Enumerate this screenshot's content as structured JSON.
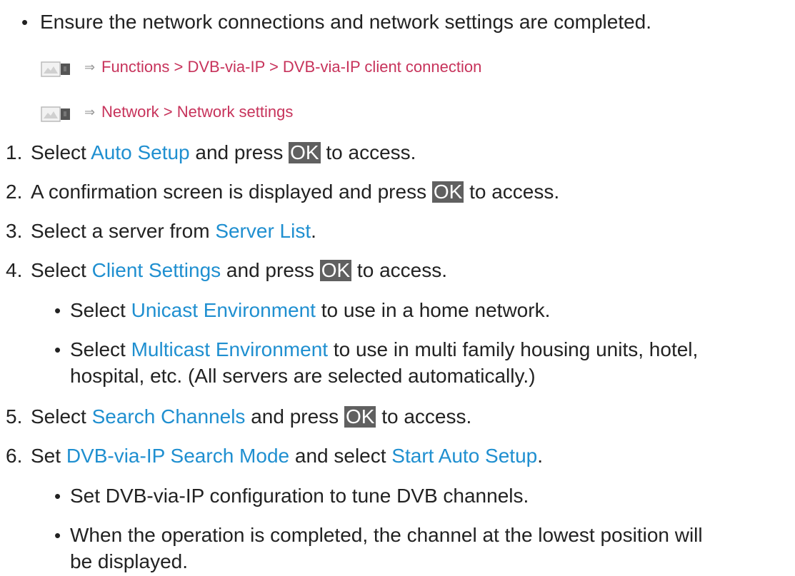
{
  "intro": {
    "bullet": "•",
    "text": "Ensure the network connections and network settings are completed."
  },
  "references": [
    {
      "icon": "tv-menu-icon",
      "arrow": "⇒",
      "path": "Functions > DVB-via-IP > DVB-via-IP client connection"
    },
    {
      "icon": "tv-menu-icon",
      "arrow": "⇒",
      "path": "Network > Network settings"
    }
  ],
  "steps": [
    {
      "num": "1.",
      "pre": "Select ",
      "link": "Auto Setup",
      "mid": " and press ",
      "key": "OK",
      "post": " to access."
    },
    {
      "num": "2.",
      "pre": "A confirmation screen is displayed and press ",
      "key": "OK",
      "post": " to access."
    },
    {
      "num": "3.",
      "pre": "Select a server from ",
      "link": "Server List",
      "post": "."
    },
    {
      "num": "4.",
      "pre": "Select ",
      "link": "Client Settings",
      "mid": " and press ",
      "key": "OK",
      "post": " to access."
    },
    {
      "num": "5.",
      "pre": "Select ",
      "link": "Search Channels",
      "mid": " and press ",
      "key": "OK",
      "post": " to access."
    },
    {
      "num": "6.",
      "pre": "Set ",
      "link": "DVB-via-IP Search Mode",
      "mid": " and select ",
      "link2": "Start Auto Setup",
      "post": "."
    }
  ],
  "step4_sub": [
    {
      "bullet": "•",
      "pre": "Select ",
      "link": "Unicast Environment",
      "post": " to use in a home network."
    },
    {
      "bullet": "•",
      "pre": "Select ",
      "link": "Multicast Environment",
      "post": " to use in multi family housing units, hotel,",
      "cont": "hospital, etc. (All servers are selected automatically.)"
    }
  ],
  "step6_sub": [
    {
      "bullet": "•",
      "text": "Set DVB-via-IP configuration to tune DVB channels."
    },
    {
      "bullet": "•",
      "text": "When the operation is completed, the channel at the lowest position will",
      "cont": "be displayed."
    }
  ],
  "colors": {
    "link": "#1f8fd0",
    "reference": "#c7335b",
    "key_bg": "#606060",
    "text": "#222222"
  }
}
